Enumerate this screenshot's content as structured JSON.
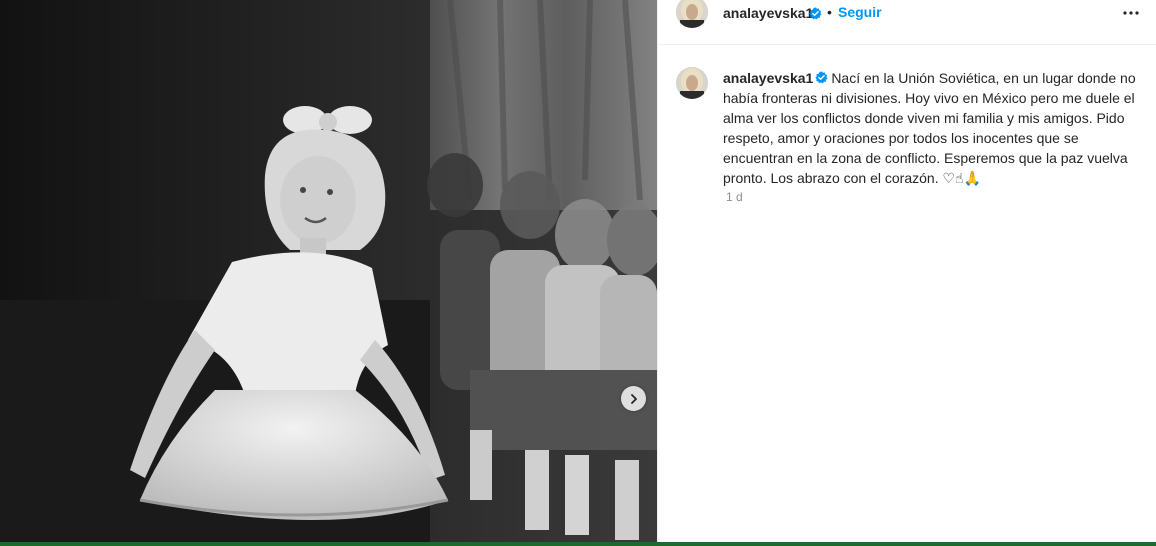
{
  "post": {
    "username": "analayevska1",
    "follow_label": "Seguir",
    "separator": "•",
    "caption_text": "Nací en la Unión Soviética, en un lugar donde no había fronteras ni divisiones. Hoy vivo en México pero me duele el alma ver los conflictos donde viven mi familia y mis amigos. Pido respeto, amor y oraciones por todos los inocentes que se encuentran en la zona de conflicto. Esperemos que la paz vuelva pronto. Los abrazo con el corazón.",
    "caption_emojis": "♡☝🙏",
    "timestamp": "1 d"
  },
  "icons": {
    "verified": "verified-badge-icon",
    "more": "more-options-icon",
    "next": "chevron-right-icon"
  },
  "colors": {
    "link_blue": "#0095f6",
    "verified_blue": "#0095f6",
    "text": "#262626",
    "muted": "#8e8e8e",
    "bottom_bar": "#1d6b2a"
  }
}
